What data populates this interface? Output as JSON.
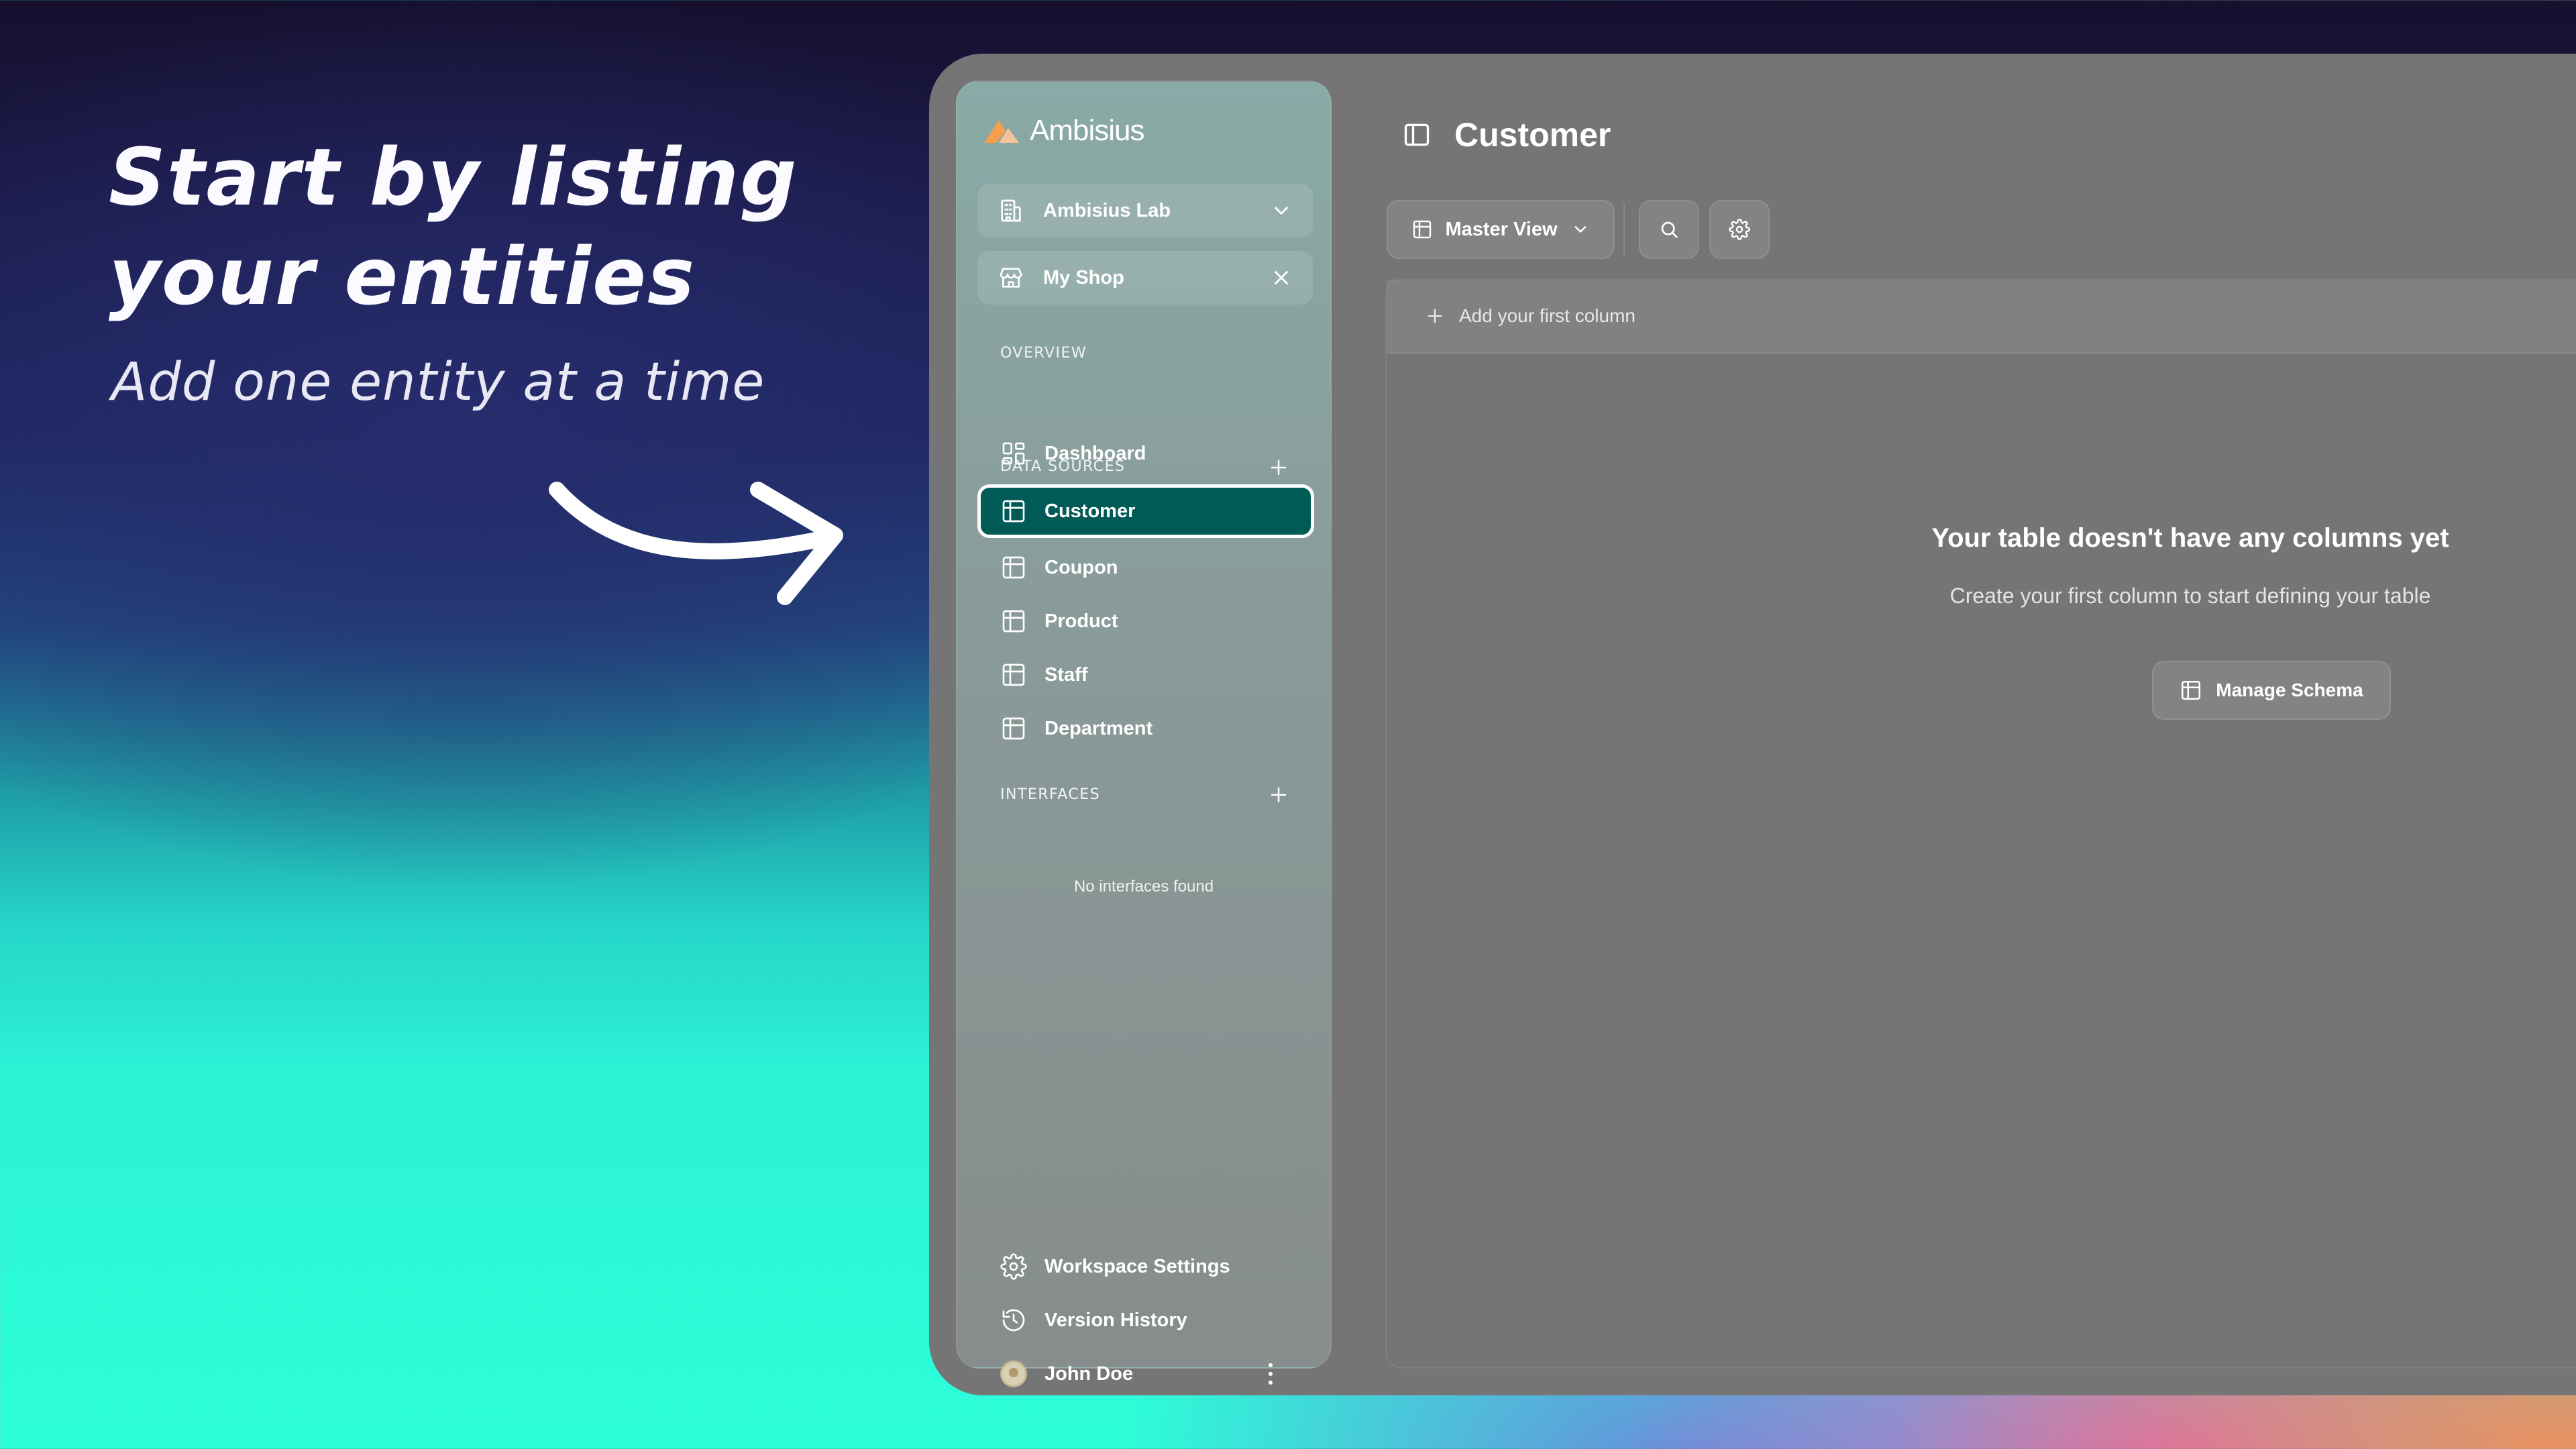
{
  "hero": {
    "title_line1": "Start by listing",
    "title_line2": "your entities",
    "subtitle": "Add one entity at a time"
  },
  "app": {
    "brand": "Ambisius",
    "workspace": "Ambisius Lab",
    "store": "My Shop",
    "sections": {
      "overview": "OVERVIEW",
      "data_sources": "DATA SOURCES",
      "interfaces": "INTERFACES"
    },
    "overview_items": [
      {
        "label": "Dashboard",
        "icon": "dashboard-icon"
      }
    ],
    "data_sources": [
      {
        "label": "Customer",
        "icon": "table-icon",
        "active": true
      },
      {
        "label": "Coupon",
        "icon": "table-icon"
      },
      {
        "label": "Product",
        "icon": "table-icon"
      },
      {
        "label": "Staff",
        "icon": "table-icon"
      },
      {
        "label": "Department",
        "icon": "table-icon"
      }
    ],
    "interfaces_empty": "No interfaces found",
    "footer": {
      "settings": "Workspace Settings",
      "history": "Version History",
      "user": "John Doe"
    }
  },
  "main": {
    "title": "Customer",
    "view_label": "Master View",
    "add_column": "Add your first column",
    "empty_title": "Your table doesn't have any columns yet",
    "empty_desc": "Create your first column to start defining your table",
    "manage_button": "Manage Schema"
  },
  "colors": {
    "active_item": "#005a55",
    "brand_orange": "#f6a04d",
    "brand_peach": "#f3c39a"
  }
}
